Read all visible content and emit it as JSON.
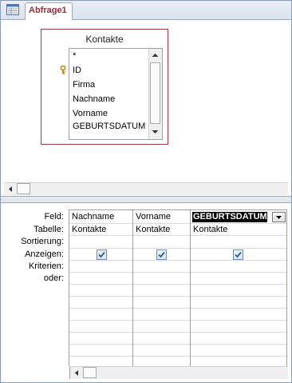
{
  "tab": {
    "title": "Abfrage1",
    "icon": "query-document-icon"
  },
  "table": {
    "title": "Kontakte",
    "fields": [
      "*",
      "ID",
      "Firma",
      "Nachname",
      "Vorname",
      "GEBURTSDATUM"
    ],
    "primary_key_icon": "key-icon"
  },
  "grid": {
    "row_labels": [
      "Feld:",
      "Tabelle:",
      "Sortierung:",
      "Anzeigen:",
      "Kriterien:",
      "oder:"
    ],
    "columns": [
      {
        "field": "Nachname",
        "table": "Kontakte",
        "show": true
      },
      {
        "field": "Vorname",
        "table": "Kontakte",
        "show": true
      },
      {
        "field": "GEBURTSDATUM",
        "table": "Kontakte",
        "show": true
      }
    ]
  },
  "colors": {
    "tab_title": "#9c2a33",
    "table_border": "#a33a4a",
    "frame_border": "#8b9bb4",
    "checkbox_check": "#2a5aa8"
  }
}
